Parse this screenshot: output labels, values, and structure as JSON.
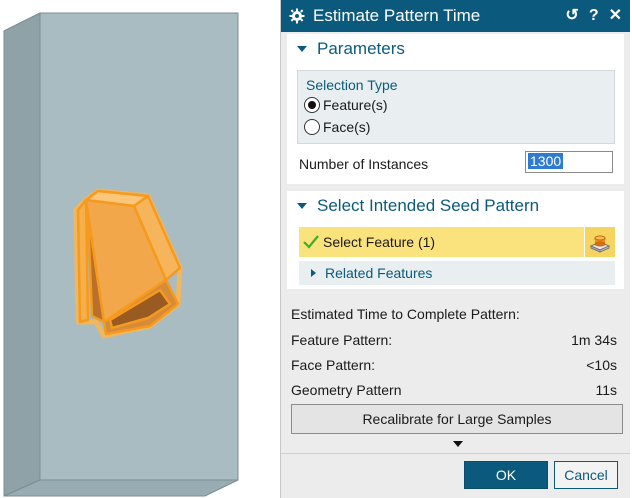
{
  "dialog": {
    "title": "Estimate Pattern Time",
    "reset_label": "↺",
    "help_label": "?",
    "close_label": "✕"
  },
  "parameters": {
    "header": "Parameters",
    "selection_type_label": "Selection Type",
    "options": [
      "Feature(s)",
      "Face(s)"
    ],
    "selected_option": "Feature(s)",
    "instances_label": "Number of Instances",
    "instances_value": "1300"
  },
  "seed_pattern": {
    "header": "Select Intended Seed Pattern",
    "select_feature_label": "Select Feature (1)",
    "related_features_label": "Related Features"
  },
  "estimates": {
    "title": "Estimated Time to Complete Pattern:",
    "rows": [
      {
        "label": "Feature Pattern:",
        "value": "1m 34s"
      },
      {
        "label": "Face Pattern:",
        "value": "<10s"
      },
      {
        "label": "Geometry Pattern",
        "value": "11s"
      }
    ]
  },
  "buttons": {
    "recalibrate": "Recalibrate for Large Samples",
    "ok": "OK",
    "cancel": "Cancel"
  },
  "colors": {
    "accent": "#0b5a7d",
    "highlight": "#fae27d",
    "model_body": "#a9bcc1",
    "feature": "#f4a33c"
  },
  "icons": [
    "gear-icon",
    "reset-icon",
    "help-icon",
    "close-icon",
    "checkmark-icon",
    "select-feature-icon"
  ]
}
